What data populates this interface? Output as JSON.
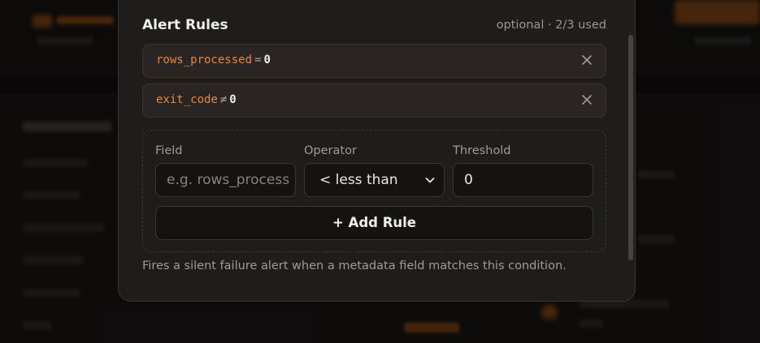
{
  "alert_rules": {
    "title": "Alert Rules",
    "meta": "optional · 2/3 used",
    "rules": [
      {
        "field": "rows_processed",
        "operator": "=",
        "value": "0"
      },
      {
        "field": "exit_code",
        "operator": "≠",
        "value": "0"
      }
    ],
    "remove_icon": "close-icon"
  },
  "builder": {
    "field_label": "Field",
    "field_placeholder": "e.g. rows_process",
    "operator_label": "Operator",
    "operator_value": "< less than",
    "threshold_label": "Threshold",
    "threshold_value": "0",
    "add_button": "+ Add Rule"
  },
  "helper_text": "Fires a silent failure alert when a metadata field matches this condition.",
  "colors": {
    "accent": "#e8883a",
    "modal_bg": "#201c1a",
    "input_bg": "#151211"
  }
}
